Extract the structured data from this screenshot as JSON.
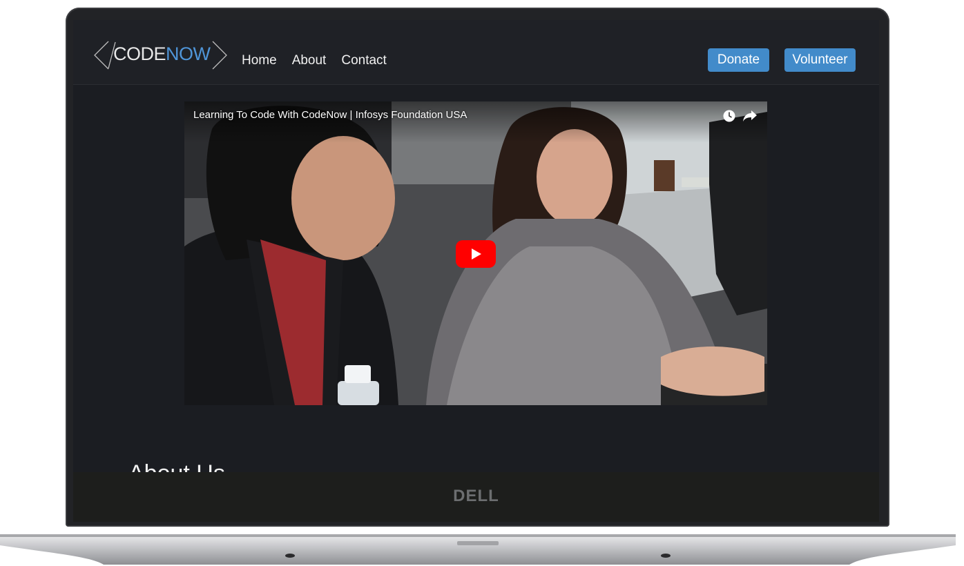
{
  "brand": {
    "logo_code": "CODE",
    "logo_now": "NOW"
  },
  "nav": {
    "links": [
      "Home",
      "About",
      "Contact"
    ]
  },
  "actions": {
    "donate": "Donate",
    "volunteer": "Volunteer"
  },
  "video": {
    "title": "Learning To Code With CodeNow | Infosys Foundation USA"
  },
  "about": {
    "heading": "About Us"
  },
  "device": {
    "brand": "DELL"
  },
  "colors": {
    "accent": "#428bca",
    "logo_now": "#4f95d8",
    "page_bg": "#1b1d22",
    "youtube_red": "#ff0000"
  },
  "icons": [
    "watch-later-icon",
    "share-icon",
    "play-icon"
  ]
}
